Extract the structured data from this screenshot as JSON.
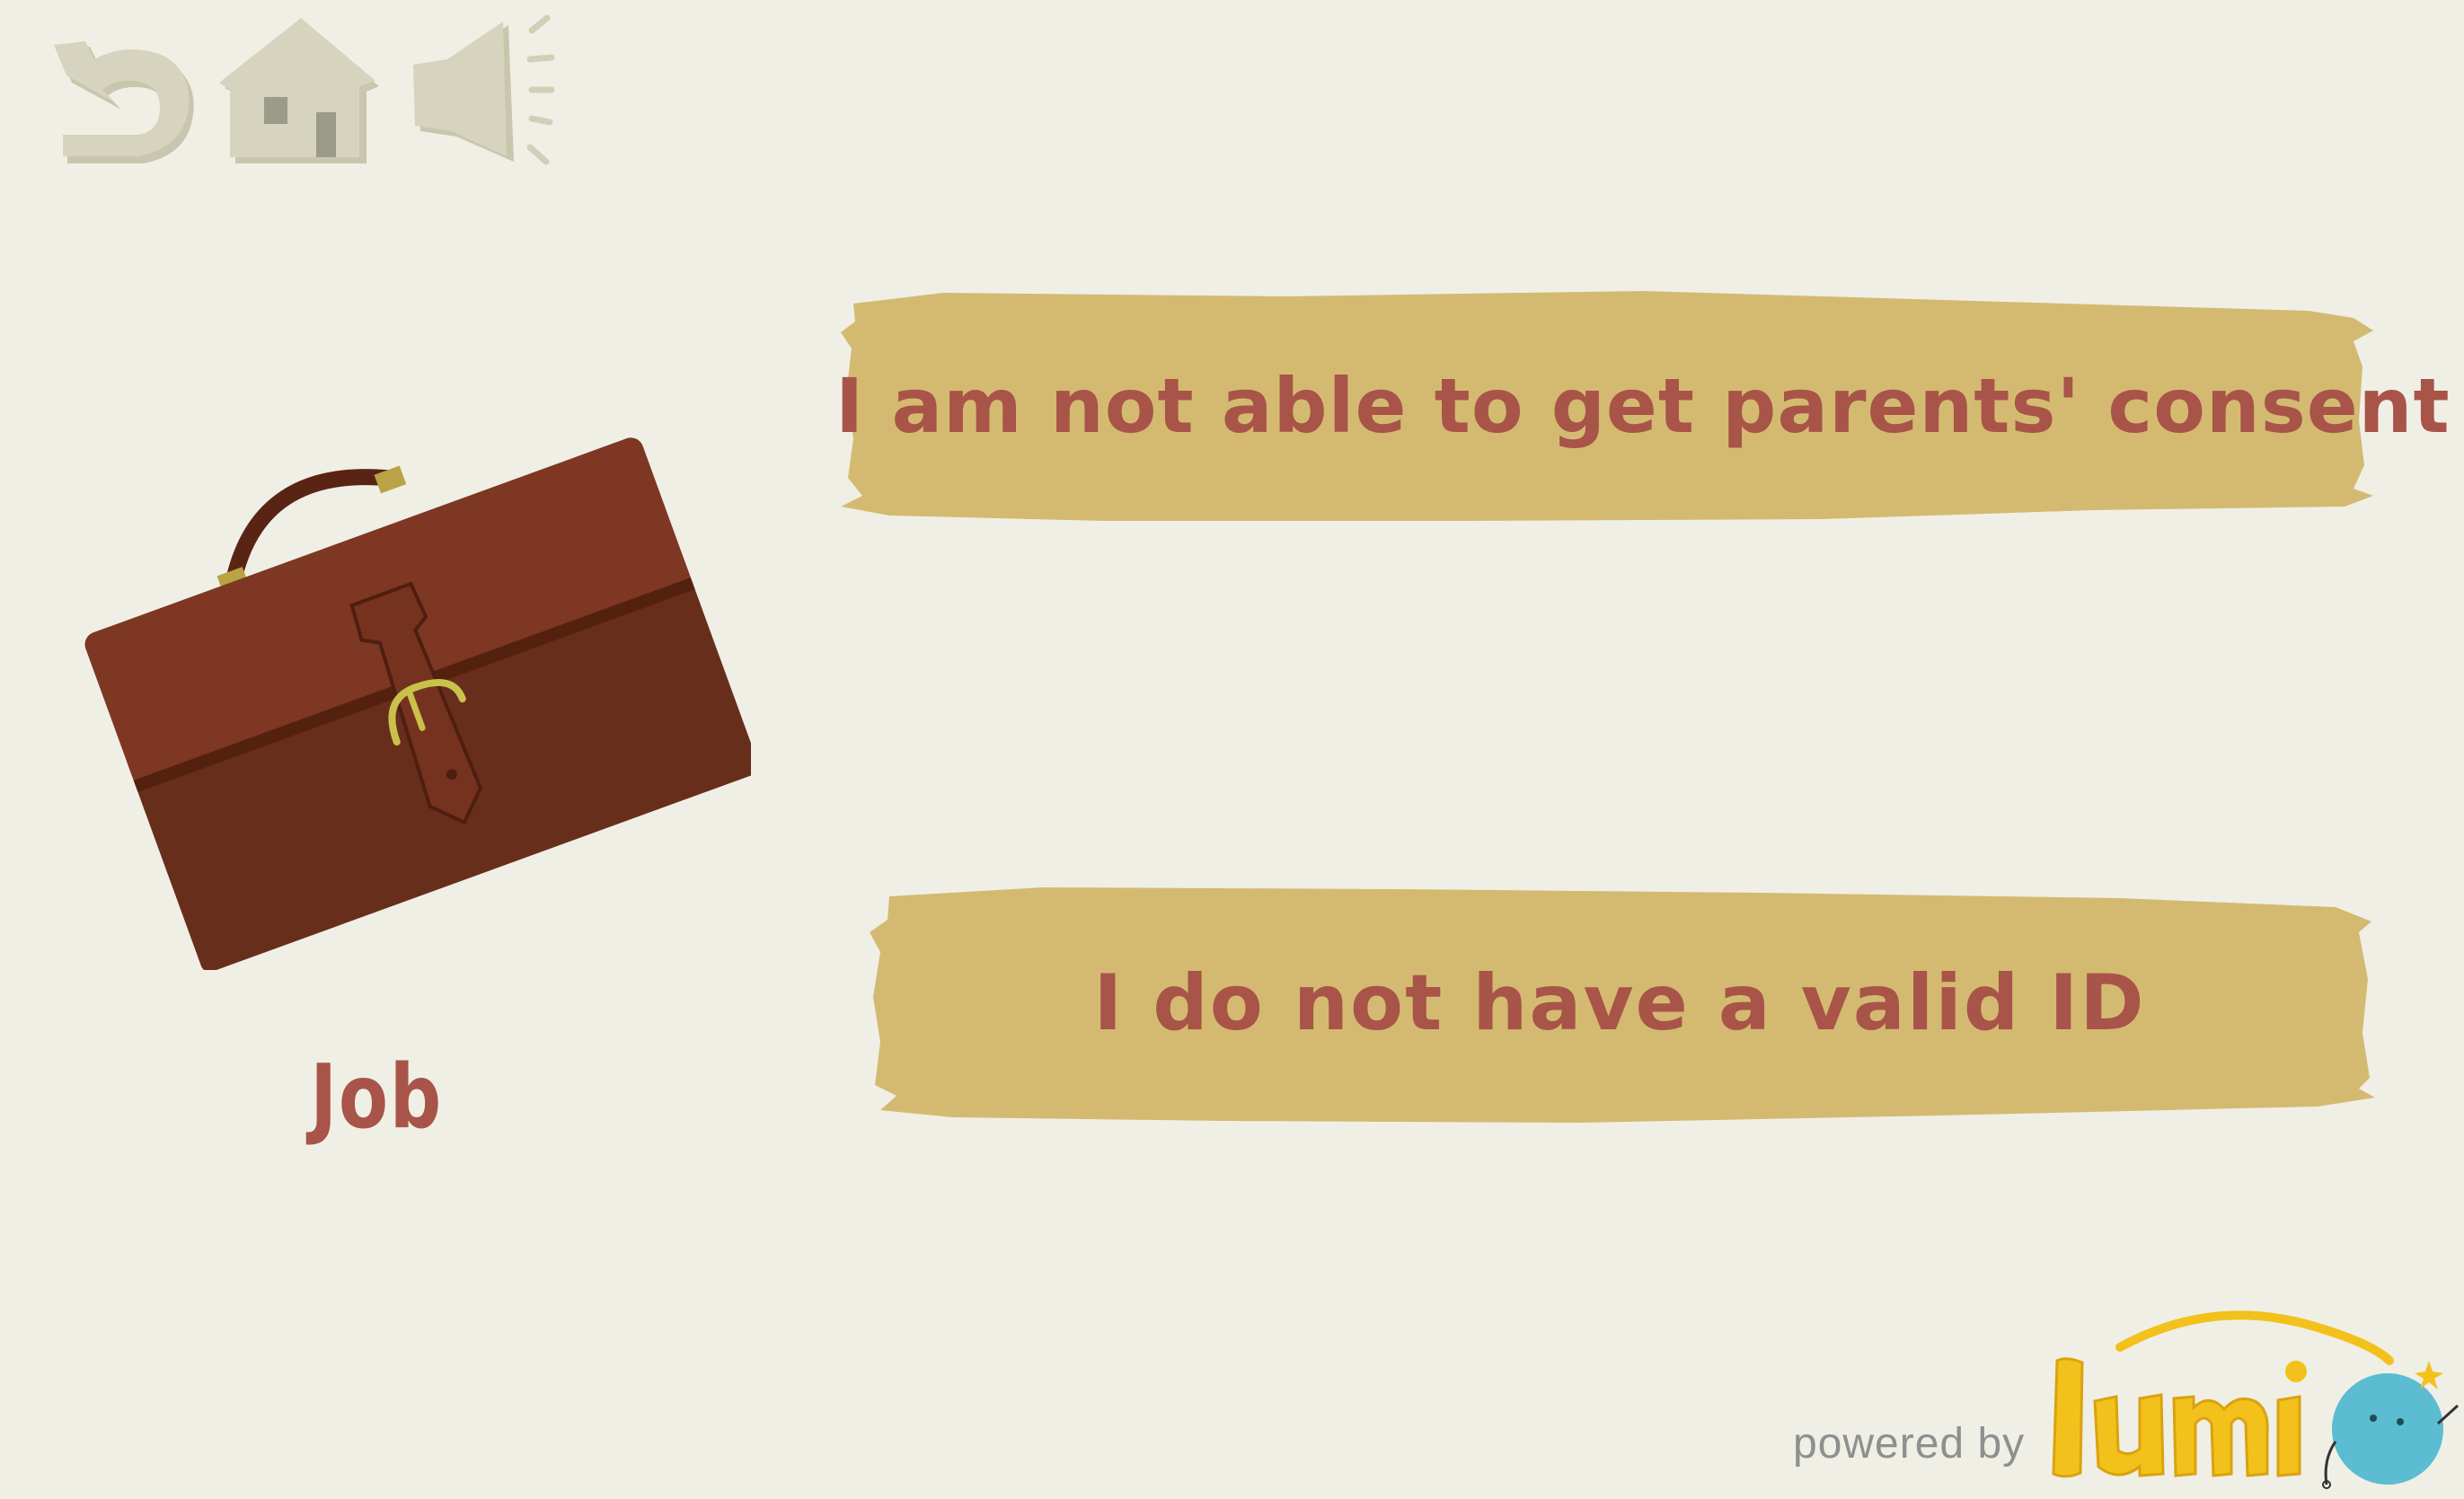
{
  "toolbar": {
    "back_icon": "back-arrow-icon",
    "home_icon": "home-icon",
    "sound_icon": "speaker-icon"
  },
  "category": {
    "label": "Job",
    "image": "briefcase"
  },
  "options": [
    {
      "label": "I am not able to get parents' consent"
    },
    {
      "label": "I do not have a valid ID"
    }
  ],
  "footer": {
    "powered_by": "powered by",
    "brand": "lumi"
  },
  "colors": {
    "background": "#f0efe6",
    "icon": "#d2cfb8",
    "option_fill": "#d4ba71",
    "text": "#a85449",
    "briefcase": "#7d3723",
    "brand_yellow": "#f3c11b",
    "brand_blue": "#5bbcd2"
  }
}
